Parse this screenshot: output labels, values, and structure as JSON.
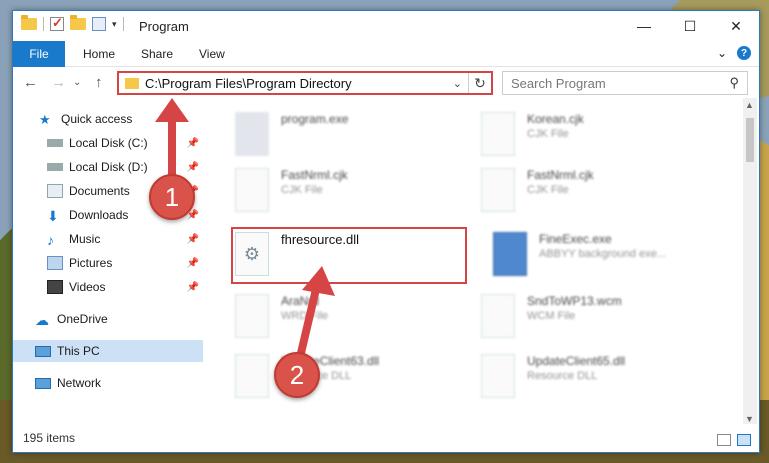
{
  "window": {
    "title": "Program",
    "minimize_label": "—",
    "maximize_label": "☐",
    "close_label": "✕"
  },
  "ribbon": {
    "tabs": [
      "File",
      "Home",
      "Share",
      "View"
    ],
    "collapse_label": "⌄",
    "help_label": "?"
  },
  "address": {
    "path": "C:\\Program Files\\Program Directory",
    "back": "←",
    "forward": "→",
    "recent": "⌄",
    "up": "↑",
    "dropdown": "⌄",
    "refresh": "↻"
  },
  "search": {
    "placeholder": "Search Program",
    "icon": "⚲"
  },
  "nav": {
    "items": [
      {
        "label": "Quick access",
        "icon": "star-icon"
      },
      {
        "label": "Local Disk (C:)",
        "icon": "disk-icon"
      },
      {
        "label": "Local Disk (D:)",
        "icon": "disk-icon"
      },
      {
        "label": "Documents",
        "icon": "documents-icon"
      },
      {
        "label": "Downloads",
        "icon": "downloads-icon"
      },
      {
        "label": "Music",
        "icon": "music-icon"
      },
      {
        "label": "Pictures",
        "icon": "pictures-icon"
      },
      {
        "label": "Videos",
        "icon": "videos-icon"
      },
      {
        "label": "OneDrive",
        "icon": "cloud-icon"
      },
      {
        "label": "This PC",
        "icon": "pc-icon"
      },
      {
        "label": "Network",
        "icon": "network-icon"
      }
    ]
  },
  "files": [
    {
      "name": "program.exe",
      "type": ""
    },
    {
      "name": "Korean.cjk",
      "type": "CJK File"
    },
    {
      "name": "FastNrml.cjk",
      "type": "CJK File"
    },
    {
      "name": "FastNrml.cjk",
      "type": "CJK File"
    },
    {
      "name": "fhresource.dll",
      "type": ""
    },
    {
      "name": "FineExec.exe",
      "type": "ABBYY background exe..."
    },
    {
      "name": "AraNrd",
      "type": "WRD File"
    },
    {
      "name": "SndToWP13.wcm",
      "type": "WCM File"
    },
    {
      "name": "UpdateClient63.dll",
      "type": "Resource DLL"
    },
    {
      "name": "UpdateClient65.dll",
      "type": "Resource DLL"
    }
  ],
  "status": {
    "items": "195 items"
  },
  "callouts": {
    "one": "1",
    "two": "2"
  },
  "colors": {
    "accent": "#1979ca",
    "highlight": "#d64545",
    "badge": "#d9534a"
  }
}
